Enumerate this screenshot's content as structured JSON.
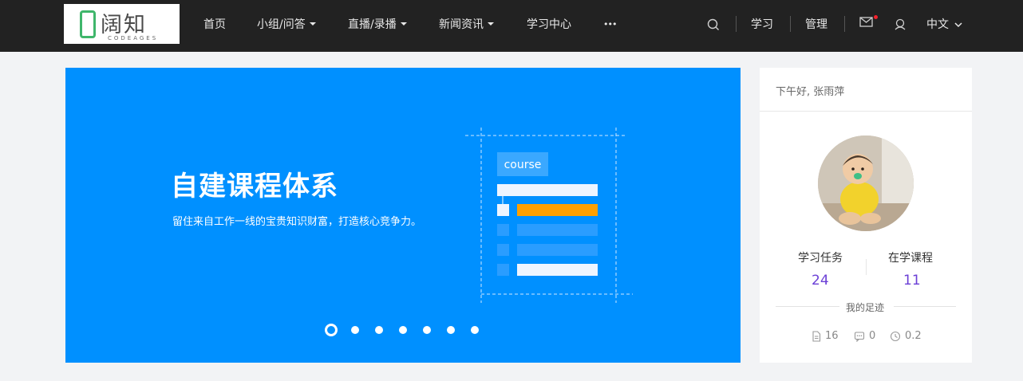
{
  "header": {
    "logo": {
      "brand": "阔知",
      "sub": "CODEAGES"
    },
    "nav": [
      {
        "label": "首页"
      },
      {
        "label": "小组/问答"
      },
      {
        "label": "直播/录播"
      },
      {
        "label": "新闻资讯"
      },
      {
        "label": "学习中心"
      },
      {
        "label": "•••"
      }
    ],
    "right": {
      "study": "学习",
      "manage": "管理",
      "language": "中文"
    },
    "icons": {
      "search": "search-icon",
      "mail": "mail-icon",
      "user": "user-icon"
    },
    "notification_color": "#f5222d"
  },
  "banner": {
    "title": "自建课程体系",
    "subtitle": "留住来自工作一线的宝贵知识财富，打造核心竞争力。",
    "illustration_tag": "course",
    "slide_count": 7,
    "active_slide": 1,
    "background": "#0090ff",
    "accent": "#ffa000"
  },
  "user_card": {
    "greeting": "下午好, 张雨萍",
    "stats": [
      {
        "label": "学习任务",
        "value": "24"
      },
      {
        "label": "在学课程",
        "value": "11"
      }
    ],
    "footprint_title": "我的足迹",
    "footprints": [
      {
        "icon": "document-icon",
        "value": "16"
      },
      {
        "icon": "comment-icon",
        "value": "0"
      },
      {
        "icon": "clock-icon",
        "value": "0.2"
      }
    ],
    "stat_color": "#6b3fd6"
  }
}
